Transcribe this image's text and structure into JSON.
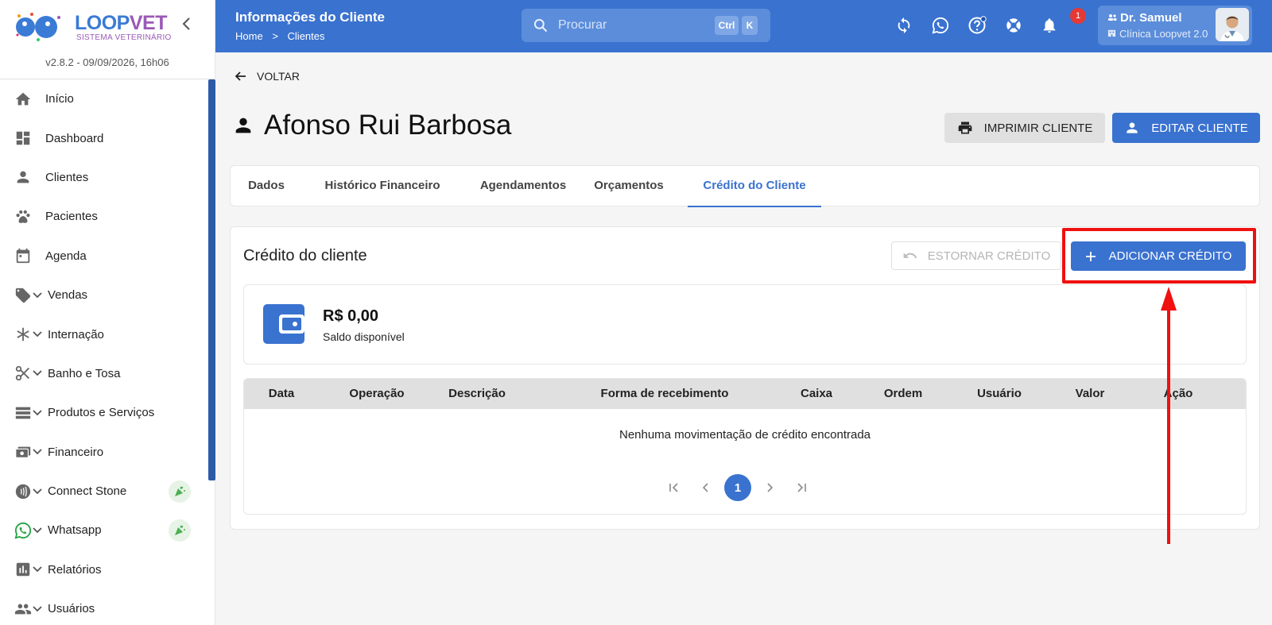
{
  "app": {
    "logo_loop": "LOOP",
    "logo_vet": "VET",
    "logo_subtitle": "SISTEMA VETERINÁRIO",
    "version": "v2.8.2 - 09/09/2026, 16h06"
  },
  "sidebar": {
    "items": [
      {
        "label": "Início",
        "icon": "home-icon"
      },
      {
        "label": "Dashboard",
        "icon": "dashboard-icon"
      },
      {
        "label": "Clientes",
        "icon": "person-icon"
      },
      {
        "label": "Pacientes",
        "icon": "paw-icon"
      },
      {
        "label": "Agenda",
        "icon": "calendar-icon"
      },
      {
        "label": "Vendas",
        "icon": "tag-icon"
      },
      {
        "label": "Internação",
        "icon": "asterisk-icon"
      },
      {
        "label": "Banho e Tosa",
        "icon": "scissors-icon"
      },
      {
        "label": "Produtos e Serviços",
        "icon": "list-icon"
      },
      {
        "label": "Financeiro",
        "icon": "money-icon"
      },
      {
        "label": "Connect Stone",
        "icon": "contactless-icon"
      },
      {
        "label": "Whatsapp",
        "icon": "whatsapp-icon"
      },
      {
        "label": "Relatórios",
        "icon": "bar-chart-icon"
      },
      {
        "label": "Usuários",
        "icon": "group-icon"
      }
    ]
  },
  "header": {
    "title": "Informações do Cliente",
    "breadcrumb": [
      "Home",
      ">",
      "Clientes"
    ],
    "search_placeholder": "Procurar",
    "shortcut_ctrl": "Ctrl",
    "shortcut_k": "K",
    "notifications_count": "1",
    "user_name": "Dr. Samuel",
    "user_clinic": "Clínica Loopvet 2.0"
  },
  "main": {
    "back_label": "VOLTAR",
    "client_name": "Afonso Rui Barbosa",
    "print_button": "IMPRIMIR CLIENTE",
    "edit_button": "EDITAR CLIENTE",
    "tabs": [
      "Dados",
      "Histórico Financeiro",
      "Agendamentos",
      "Orçamentos",
      "Crédito do Cliente"
    ],
    "active_tab": "Crédito do Cliente"
  },
  "credit": {
    "title": "Crédito do cliente",
    "refund_button": "ESTORNAR CRÉDITO",
    "add_button": "ADICIONAR CRÉDITO",
    "balance_amount": "R$ 0,00",
    "balance_label": "Saldo disponível",
    "table_headers": [
      "Data",
      "Operação",
      "Descrição",
      "Forma de recebimento",
      "Caixa",
      "Ordem",
      "Usuário",
      "Valor",
      "Ação"
    ],
    "empty_message": "Nenhuma movimentação de crédito encontrada",
    "current_page": "1"
  },
  "colors": {
    "primary": "#3a72cf",
    "highlight": "#f01010"
  }
}
